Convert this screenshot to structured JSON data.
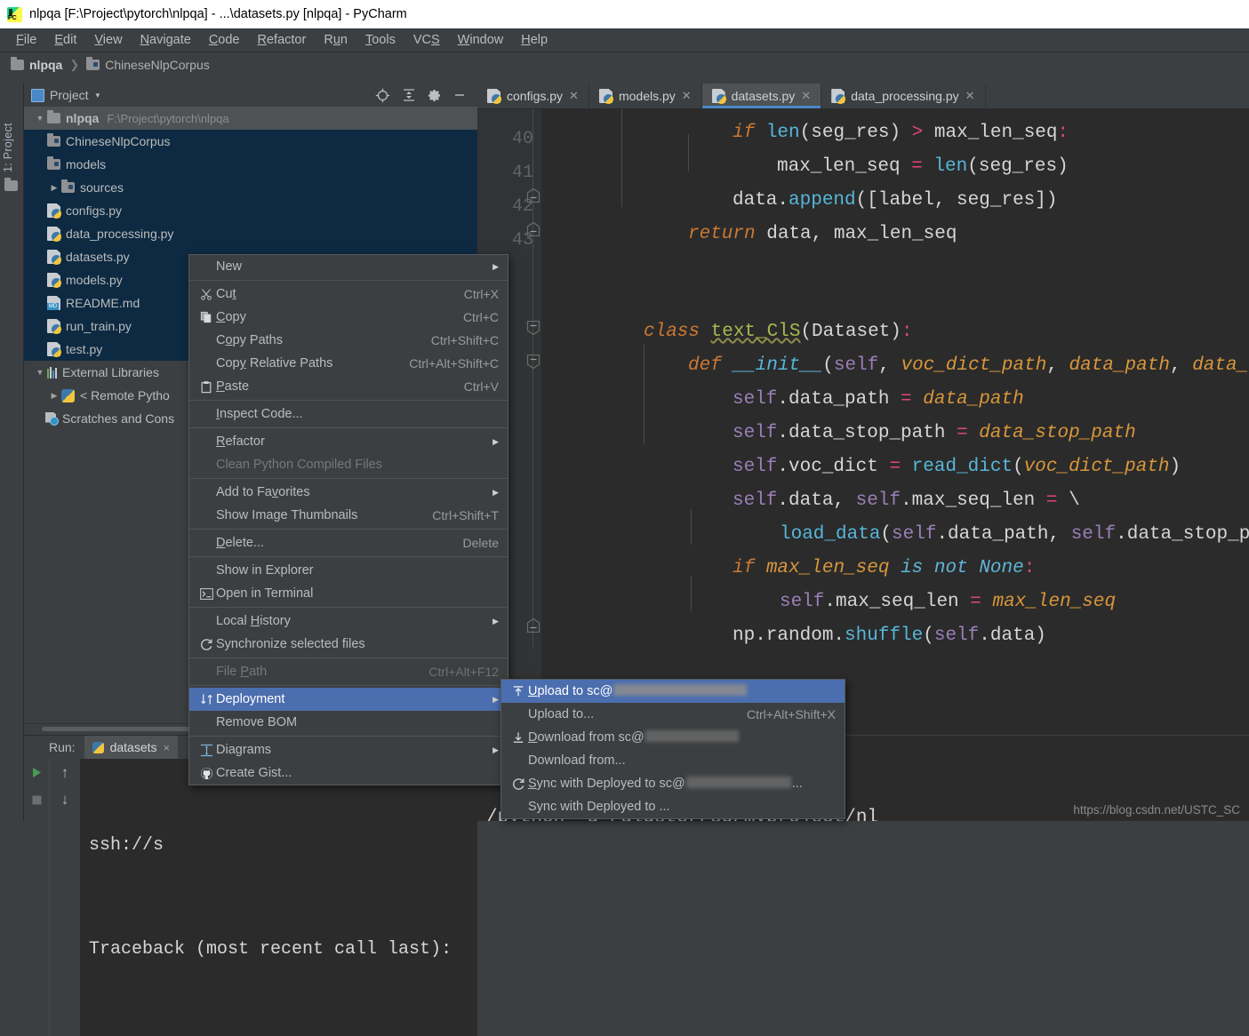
{
  "window": {
    "title": "nlpqa [F:\\Project\\pytorch\\nlpqa] - ...\\datasets.py [nlpqa] - PyCharm",
    "app_icon": "pycharm-logo-icon"
  },
  "menubar": [
    {
      "label": "File",
      "mnemonic": "F"
    },
    {
      "label": "Edit",
      "mnemonic": "E"
    },
    {
      "label": "View",
      "mnemonic": "V"
    },
    {
      "label": "Navigate",
      "mnemonic": "N"
    },
    {
      "label": "Code",
      "mnemonic": "C"
    },
    {
      "label": "Refactor",
      "mnemonic": "R"
    },
    {
      "label": "Run",
      "mnemonic": "u"
    },
    {
      "label": "Tools",
      "mnemonic": "T"
    },
    {
      "label": "VCS",
      "mnemonic": "S"
    },
    {
      "label": "Window",
      "mnemonic": "W"
    },
    {
      "label": "Help",
      "mnemonic": "H"
    }
  ],
  "breadcrumb": {
    "items": [
      "nlpqa",
      "ChineseNlpCorpus"
    ],
    "separator": "❯"
  },
  "toolstrip": {
    "label": "1: Project",
    "folder_icon": "folder-icon"
  },
  "project_panel": {
    "title": "Project",
    "caret": "▾",
    "tools": [
      "locate-icon",
      "collapse-all-icon",
      "settings-gear-icon",
      "hide-icon"
    ],
    "tree": [
      {
        "label": "nlpqa",
        "path": "F:\\Project\\pytorch\\nlpqa",
        "icon": "folder-icon",
        "twisty": "▼",
        "depth": 0,
        "state": "root"
      },
      {
        "label": "ChineseNlpCorpus",
        "icon": "source-folder-icon",
        "twisty": "",
        "depth": 1,
        "state": "selected"
      },
      {
        "label": "models",
        "icon": "source-folder-icon",
        "twisty": "",
        "depth": 1,
        "state": "selected"
      },
      {
        "label": "sources",
        "icon": "source-folder-icon",
        "twisty": "▶",
        "depth": 1,
        "state": "selected"
      },
      {
        "label": "configs.py",
        "icon": "python-file-icon",
        "twisty": "",
        "depth": 1,
        "state": "selected"
      },
      {
        "label": "data_processing.py",
        "icon": "python-file-icon",
        "twisty": "",
        "depth": 1,
        "state": "selected"
      },
      {
        "label": "datasets.py",
        "icon": "python-file-icon",
        "twisty": "",
        "depth": 1,
        "state": "selected"
      },
      {
        "label": "models.py",
        "icon": "python-file-icon",
        "twisty": "",
        "depth": 1,
        "state": "selected"
      },
      {
        "label": "README.md",
        "icon": "markdown-file-icon",
        "twisty": "",
        "depth": 1,
        "state": "selected"
      },
      {
        "label": "run_train.py",
        "icon": "python-file-icon",
        "twisty": "",
        "depth": 1,
        "state": "selected"
      },
      {
        "label": "test.py",
        "icon": "python-file-icon",
        "twisty": "",
        "depth": 1,
        "state": "selected"
      },
      {
        "label": "External Libraries",
        "icon": "libraries-icon",
        "twisty": "▼",
        "depth": 0,
        "state": "normal"
      },
      {
        "label": "< Remote Pytho",
        "icon": "python-interpreter-icon",
        "twisty": "▶",
        "depth": 1,
        "state": "normal"
      },
      {
        "label": "Scratches and Cons",
        "icon": "scratches-icon",
        "twisty": "",
        "depth": 1,
        "state": "normal"
      }
    ]
  },
  "editor_tabs": [
    {
      "label": "configs.py",
      "icon": "python-file-icon",
      "active": false
    },
    {
      "label": "models.py",
      "icon": "python-file-icon",
      "active": false
    },
    {
      "label": "datasets.py",
      "icon": "python-file-icon",
      "active": true
    },
    {
      "label": "data_processing.py",
      "icon": "python-file-icon",
      "active": false
    }
  ],
  "editor": {
    "line_numbers": [
      "40",
      "41",
      "42",
      "43"
    ],
    "code_lines": [
      "            if len(seg_res) > max_len_seq:",
      "                max_len_seq = len(seg_res)",
      "            data.append([label, seg_res])",
      "        return data, max_len_seq",
      "",
      "",
      "class text_ClS(Dataset):",
      "    def __init__(self, voc_dict_path, data_path, data_stop",
      "        self.data_path = data_path",
      "        self.data_stop_path = data_stop_path",
      "        self.voc_dict = read_dict(voc_dict_path)",
      "        self.data, self.max_seq_len = \\",
      "            load_data(self.data_path, self.data_stop_path)",
      "        if max_len_seq is not None:",
      "            self.max_seq_len = max_len_seq",
      "        np.random.shuffle(self.data)"
    ]
  },
  "run_panel": {
    "label": "Run:",
    "tab": "datasets",
    "tab_close": "×",
    "buttons": [
      "run-icon",
      "stop-icon",
      "scroll-up-icon",
      "scroll-down-icon"
    ],
    "console_line_1_left": "ssh://s",
    "console_line_1_right": "/python -u /gluster/sc/myproject/nl",
    "console_line_2": "Traceback (most recent call last):",
    "watermark": "https://blog.csdn.net/USTC_SC"
  },
  "context_menu": {
    "items": [
      {
        "label": "New",
        "mnemonic": "",
        "accel": "",
        "icon": "",
        "submenu": true,
        "state": "normal"
      },
      {
        "separator": true
      },
      {
        "label": "Cut",
        "mnemonic": "t",
        "accel": "Ctrl+X",
        "icon": "scissors-icon",
        "submenu": false,
        "state": "normal"
      },
      {
        "label": "Copy",
        "mnemonic": "C",
        "accel": "Ctrl+C",
        "icon": "copy-icon",
        "submenu": false,
        "state": "normal"
      },
      {
        "label": "Copy Paths",
        "mnemonic": "o",
        "accel": "Ctrl+Shift+C",
        "icon": "",
        "submenu": false,
        "state": "normal"
      },
      {
        "label": "Copy Relative Paths",
        "mnemonic": "y",
        "accel": "Ctrl+Alt+Shift+C",
        "icon": "",
        "submenu": false,
        "state": "normal"
      },
      {
        "label": "Paste",
        "mnemonic": "P",
        "accel": "Ctrl+V",
        "icon": "paste-icon",
        "submenu": false,
        "state": "normal"
      },
      {
        "separator": true
      },
      {
        "label": "Inspect Code...",
        "mnemonic": "I",
        "accel": "",
        "icon": "",
        "submenu": false,
        "state": "normal"
      },
      {
        "separator": true
      },
      {
        "label": "Refactor",
        "mnemonic": "R",
        "accel": "",
        "icon": "",
        "submenu": true,
        "state": "normal"
      },
      {
        "label": "Clean Python Compiled Files",
        "mnemonic": "",
        "accel": "",
        "icon": "",
        "submenu": false,
        "state": "disabled"
      },
      {
        "separator": true
      },
      {
        "label": "Add to Favorites",
        "mnemonic": "v",
        "accel": "",
        "icon": "",
        "submenu": true,
        "state": "normal"
      },
      {
        "label": "Show Image Thumbnails",
        "mnemonic": "",
        "accel": "Ctrl+Shift+T",
        "icon": "",
        "submenu": false,
        "state": "normal"
      },
      {
        "separator": true
      },
      {
        "label": "Delete...",
        "mnemonic": "D",
        "accel": "Delete",
        "icon": "",
        "submenu": false,
        "state": "normal"
      },
      {
        "separator": true
      },
      {
        "label": "Show in Explorer",
        "mnemonic": "",
        "accel": "",
        "icon": "",
        "submenu": false,
        "state": "normal"
      },
      {
        "label": "Open in Terminal",
        "mnemonic": "",
        "accel": "",
        "icon": "terminal-icon",
        "submenu": false,
        "state": "normal"
      },
      {
        "separator": true
      },
      {
        "label": "Local History",
        "mnemonic": "H",
        "accel": "",
        "icon": "",
        "submenu": true,
        "state": "normal"
      },
      {
        "label": "Synchronize selected files",
        "mnemonic": "",
        "accel": "",
        "icon": "refresh-icon",
        "submenu": false,
        "state": "normal"
      },
      {
        "separator": true
      },
      {
        "label": "File Path",
        "mnemonic": "P",
        "accel": "Ctrl+Alt+F12",
        "icon": "",
        "submenu": false,
        "state": "disabled"
      },
      {
        "separator": true
      },
      {
        "label": "Deployment",
        "mnemonic": "",
        "accel": "",
        "icon": "deployment-icon",
        "submenu": true,
        "state": "highlighted"
      },
      {
        "label": "Remove BOM",
        "mnemonic": "",
        "accel": "",
        "icon": "",
        "submenu": false,
        "state": "normal"
      },
      {
        "separator": true
      },
      {
        "label": "Diagrams",
        "mnemonic": "",
        "accel": "",
        "icon": "diagrams-icon",
        "submenu": true,
        "state": "normal"
      },
      {
        "label": "Create Gist...",
        "mnemonic": "",
        "accel": "",
        "icon": "github-icon",
        "submenu": false,
        "state": "normal"
      }
    ]
  },
  "deployment_submenu": {
    "items": [
      {
        "label": "Upload to sc@",
        "mnemonic": "U",
        "accel": "",
        "icon": "upload-icon",
        "redacted": "long",
        "state": "highlighted"
      },
      {
        "label": "Upload to...",
        "mnemonic": "",
        "accel": "Ctrl+Alt+Shift+X",
        "icon": "",
        "redacted": "",
        "state": "normal"
      },
      {
        "label": "Download from sc@",
        "mnemonic": "D",
        "accel": "",
        "icon": "download-icon",
        "redacted": "medium",
        "state": "normal"
      },
      {
        "label": "Download from...",
        "mnemonic": "",
        "accel": "",
        "icon": "",
        "redacted": "",
        "state": "normal"
      },
      {
        "label": "Sync with Deployed to sc@",
        "mnemonic": "S",
        "accel": "",
        "icon": "sync-icon",
        "redacted": "long2",
        "state": "normal"
      },
      {
        "label": "Sync with Deployed to ...",
        "mnemonic": "",
        "accel": "",
        "icon": "",
        "redacted": "",
        "state": "normal"
      }
    ]
  },
  "colors": {
    "accent_blue": "#4b6eaf",
    "tab_underline": "#4a88c7",
    "panel_bg": "#3c3f41",
    "editor_bg": "#2b2b2b",
    "tree_selection": "#0d2a42"
  }
}
